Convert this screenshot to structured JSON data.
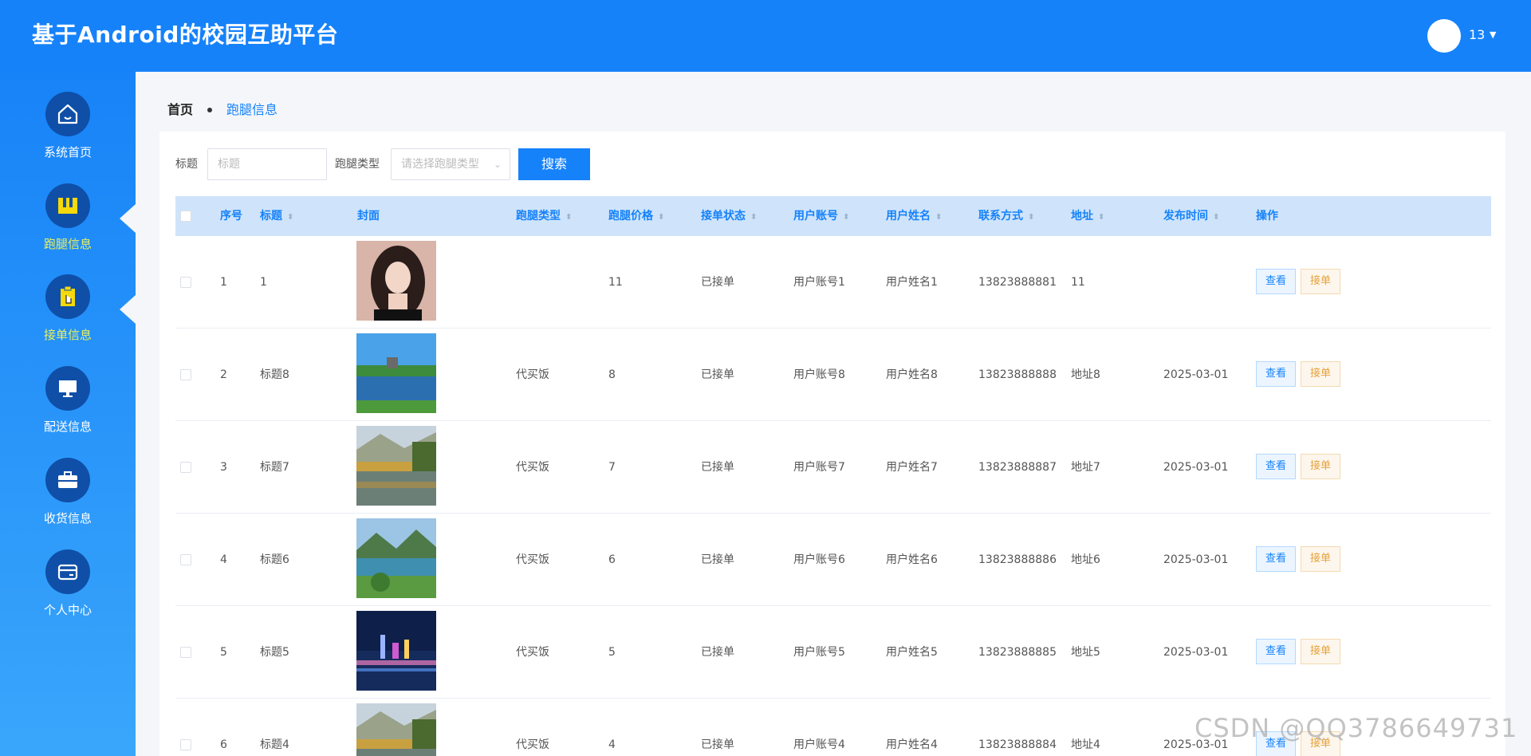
{
  "header": {
    "title": "基于Android的校园互助平台",
    "username": "13"
  },
  "sidebar": {
    "items": [
      {
        "label": "系统首页",
        "icon": "home-icon"
      },
      {
        "label": "跑腿信息",
        "icon": "book-icon"
      },
      {
        "label": "接单信息",
        "icon": "clipboard-icon"
      },
      {
        "label": "配送信息",
        "icon": "monitor-icon"
      },
      {
        "label": "收货信息",
        "icon": "briefcase-icon"
      },
      {
        "label": "个人中心",
        "icon": "wallet-icon"
      }
    ]
  },
  "breadcrumb": {
    "home": "首页",
    "current": "跑腿信息"
  },
  "search": {
    "title_label": "标题",
    "title_placeholder": "标题",
    "type_label": "跑腿类型",
    "type_placeholder": "请选择跑腿类型",
    "button": "搜索"
  },
  "table": {
    "columns": [
      "序号",
      "标题",
      "封面",
      "跑腿类型",
      "跑腿价格",
      "接单状态",
      "用户账号",
      "用户姓名",
      "联系方式",
      "地址",
      "发布时间",
      "操作"
    ],
    "rows": [
      {
        "index": "1",
        "title": "1",
        "type": "",
        "price": "11",
        "status": "已接单",
        "account": "用户账号1",
        "name": "用户姓名1",
        "phone": "13823888881",
        "address": "11",
        "time": ""
      },
      {
        "index": "2",
        "title": "标题8",
        "type": "代买饭",
        "price": "8",
        "status": "已接单",
        "account": "用户账号8",
        "name": "用户姓名8",
        "phone": "13823888888",
        "address": "地址8",
        "time": "2025-03-01"
      },
      {
        "index": "3",
        "title": "标题7",
        "type": "代买饭",
        "price": "7",
        "status": "已接单",
        "account": "用户账号7",
        "name": "用户姓名7",
        "phone": "13823888887",
        "address": "地址7",
        "time": "2025-03-01"
      },
      {
        "index": "4",
        "title": "标题6",
        "type": "代买饭",
        "price": "6",
        "status": "已接单",
        "account": "用户账号6",
        "name": "用户姓名6",
        "phone": "13823888886",
        "address": "地址6",
        "time": "2025-03-01"
      },
      {
        "index": "5",
        "title": "标题5",
        "type": "代买饭",
        "price": "5",
        "status": "已接单",
        "account": "用户账号5",
        "name": "用户姓名5",
        "phone": "13823888885",
        "address": "地址5",
        "time": "2025-03-01"
      },
      {
        "index": "6",
        "title": "标题4",
        "type": "代买饭",
        "price": "4",
        "status": "已接单",
        "account": "用户账号4",
        "name": "用户姓名4",
        "phone": "13823888884",
        "address": "地址4",
        "time": "2025-03-01"
      }
    ],
    "actions": {
      "view": "查看",
      "take": "接单"
    }
  },
  "watermark": "CSDN @QQ3786649731"
}
